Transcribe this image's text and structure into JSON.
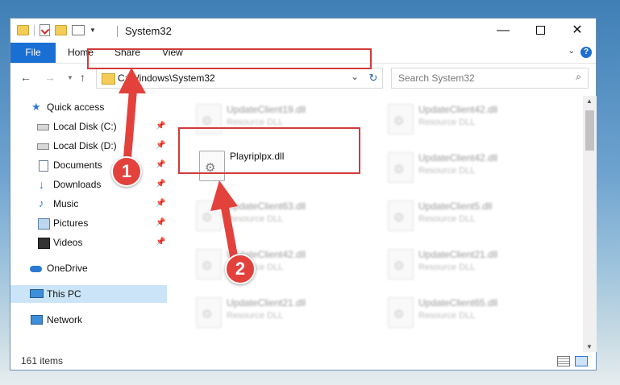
{
  "window": {
    "title": "System32",
    "controls": {
      "minimize": "—",
      "maximize": "",
      "close": "✕"
    }
  },
  "ribbon": {
    "tabs": [
      "File",
      "Home",
      "Share",
      "View"
    ],
    "help": "?"
  },
  "navigation": {
    "address_path": "C:\\Windows\\System32",
    "search_placeholder": "Search System32"
  },
  "sidebar": {
    "items": [
      {
        "label": "Quick access",
        "icon": "star-icon",
        "pinned": false
      },
      {
        "label": "Local Disk (C:)",
        "icon": "disk-icon",
        "pinned": true
      },
      {
        "label": "Local Disk (D:)",
        "icon": "disk-icon",
        "pinned": true
      },
      {
        "label": "Documents",
        "icon": "documents-icon",
        "pinned": true
      },
      {
        "label": "Downloads",
        "icon": "download-icon",
        "pinned": true
      },
      {
        "label": "Music",
        "icon": "music-icon",
        "pinned": true
      },
      {
        "label": "Pictures",
        "icon": "pictures-icon",
        "pinned": true
      },
      {
        "label": "Videos",
        "icon": "videos-icon",
        "pinned": true
      },
      {
        "label": "OneDrive",
        "icon": "onedrive-icon",
        "pinned": false
      },
      {
        "label": "This PC",
        "icon": "this-pc-icon",
        "pinned": false,
        "selected": true
      },
      {
        "label": "Network",
        "icon": "network-icon",
        "pinned": false
      }
    ],
    "pin_glyph": "📌"
  },
  "files": [
    {
      "name": "UpdateClient19.dll",
      "type": "Resource DLL",
      "blurred": true
    },
    {
      "name": "UpdateClient42.dll",
      "type": "Resource DLL",
      "blurred": true
    },
    {
      "name": "Playriplpx.dll",
      "type": "",
      "blurred": false
    },
    {
      "name": "UpdateClient42.dll",
      "type": "Resource DLL",
      "blurred": true
    },
    {
      "name": "UpdateClient63.dll",
      "type": "Resource DLL",
      "blurred": true
    },
    {
      "name": "UpdateClient5.dll",
      "type": "Resource DLL",
      "blurred": true
    },
    {
      "name": "UpdateClient42.dll",
      "type": "Resource DLL",
      "blurred": true
    },
    {
      "name": "UpdateClient21.dll",
      "type": "Resource DLL",
      "blurred": true
    },
    {
      "name": "UpdateClient21.dll",
      "type": "Resource DLL",
      "blurred": true
    },
    {
      "name": "UpdateClient65.dll",
      "type": "Resource DLL",
      "blurred": true
    }
  ],
  "status": {
    "item_count": "161 items"
  },
  "annotations": {
    "step1": "1",
    "step2": "2",
    "color": "#e3413c"
  }
}
